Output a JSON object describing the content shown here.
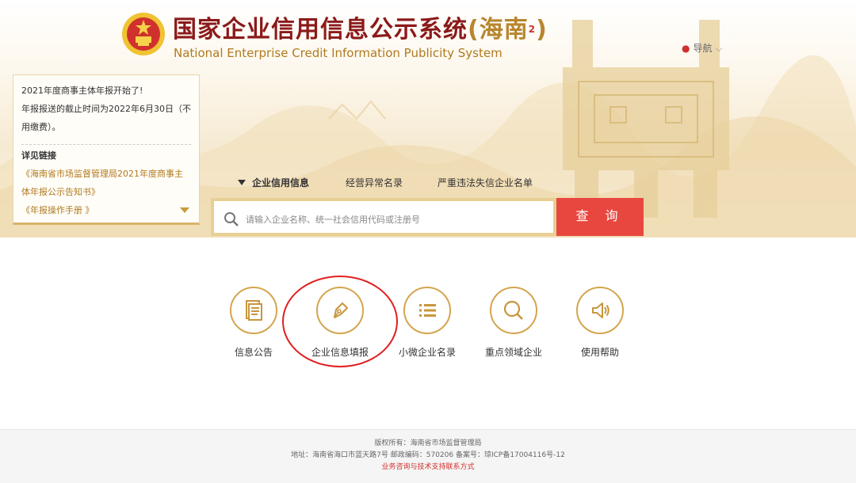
{
  "header": {
    "title_cn": "国家企业信用信息公示系统",
    "region": "(海南",
    "region_mark": "2",
    "region_close": ")",
    "title_en": "National Enterprise Credit Information Publicity System",
    "nav_label": "导航"
  },
  "notice": {
    "line1": "2021年度商事主体年报开始了!",
    "line2": "年报报送的截止时间为2022年6月30日（不用缴费）。",
    "links_header": "详见链接",
    "link1": "《海南省市场监督管理局2021年度商事主体年报公示告知书》",
    "link2": "《年报操作手册 》"
  },
  "search": {
    "tabs": [
      "企业信用信息",
      "经营异常名录",
      "严重违法失信企业名单"
    ],
    "placeholder": "请输入企业名称、统一社会信用代码或注册号",
    "button_label": "查 询"
  },
  "services": [
    {
      "label": "信息公告",
      "icon": "document-icon"
    },
    {
      "label": "企业信息填报",
      "icon": "pen-nib-icon",
      "highlighted": true
    },
    {
      "label": "小微企业名录",
      "icon": "list-icon"
    },
    {
      "label": "重点领域企业",
      "icon": "magnifier-icon"
    },
    {
      "label": "使用帮助",
      "icon": "speaker-icon"
    }
  ],
  "footer": {
    "copyright": "版权所有：海南省市场监督管理局",
    "address": "地址：海南省海口市蓝天路7号 邮政编码：570206 备案号：琼ICP备17004116号-12",
    "contact": "业务咨询与技术支持联系方式"
  },
  "colors": {
    "brand_red": "#8b1a1a",
    "gold": "#d4a54e",
    "search_button": "#e8473f",
    "highlight_circle": "#e02020"
  }
}
